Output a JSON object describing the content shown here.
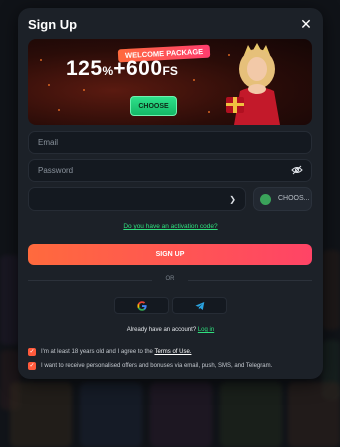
{
  "modal": {
    "title": "Sign Up",
    "close_glyph": "✕"
  },
  "banner": {
    "badge": "WELCOME PACKAGE",
    "offer_percent": "125",
    "offer_percent_unit": "%",
    "offer_plus": "+",
    "offer_fs": "600",
    "offer_fs_unit": "FS",
    "choose_label": "CHOOSE"
  },
  "form": {
    "email_placeholder": "Email",
    "password_placeholder": "Password",
    "currency_label": "CHOOS...",
    "activation_link": "Do you have an activation code?",
    "signup_label": "SIGN UP",
    "or_label": "OR"
  },
  "social": {
    "google_icon": "google-icon",
    "telegram_icon": "telegram-icon"
  },
  "account": {
    "question": "Already have an account?",
    "login_link": "Log in"
  },
  "consents": {
    "age_text": "I'm at least 18 years old and I agree to the",
    "terms_link": "Terms of Use.",
    "marketing_text": "I want to receive personalised offers and bonuses via email, push, SMS, and Telegram."
  },
  "colors": {
    "accent_green": "#2fe07e",
    "accent_orange": "#ff6a3d",
    "modal_bg": "#1c2128"
  }
}
